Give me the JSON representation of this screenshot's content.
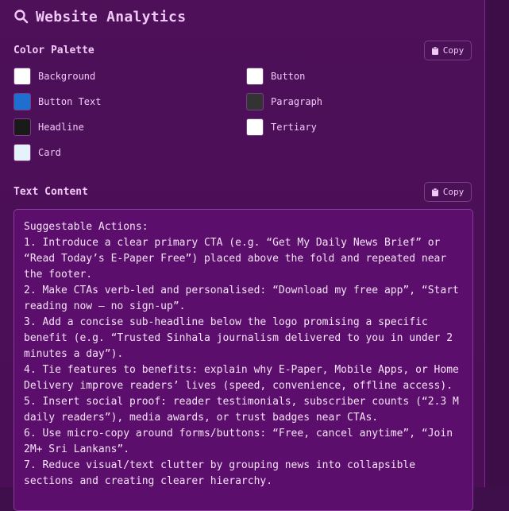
{
  "header": {
    "title": "Website Analytics",
    "icon": "search-icon"
  },
  "palette": {
    "title": "Color Palette",
    "copy_label": "Copy",
    "items": [
      {
        "label": "Background",
        "color": "#ffffff"
      },
      {
        "label": "Button",
        "color": "#ffffff"
      },
      {
        "label": "Button Text",
        "color": "#1f6fd1"
      },
      {
        "label": "Paragraph",
        "color": "#333333"
      },
      {
        "label": "Headline",
        "color": "#1a1a1a"
      },
      {
        "label": "Tertiary",
        "color": "#ffffff"
      },
      {
        "label": "Card",
        "color": "#e6f2fb"
      }
    ]
  },
  "text_content": {
    "title": "Text Content",
    "copy_label": "Copy",
    "body": "Suggestable Actions:\n1. Introduce a clear primary CTA (e.g. “Get My Daily News Brief” or “Read Today’s E-Paper Free”) placed above the fold and repeated near the footer.\n2. Make CTAs verb-led and personalised: “Download my free app”, “Start reading now – no sign-up”.\n3. Add a concise sub-headline below the logo promising a specific benefit (e.g. “Trusted Sinhala journalism delivered to you in under 2 minutes a day”).\n4. Tie features to benefits: explain why E-Paper, Mobile Apps, or Home Delivery improve readers’ lives (speed, convenience, offline access).\n5. Insert social proof: reader testimonials, subscriber counts (“2.3 M daily readers”), media awards, or trust badges near CTAs.\n6. Use micro-copy around forms/buttons: “Free, cancel anytime”, “Join 2M+ Sri Lankans”.\n7. Reduce visual/text clutter by grouping news into collapsible sections and creating clearer hierarchy."
  },
  "colors": {
    "accent": "#f0c8f6",
    "panel": "#4b0f57",
    "textbox": "#5b0e6c"
  }
}
